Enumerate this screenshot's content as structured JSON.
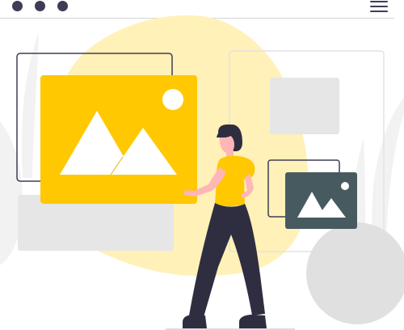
{
  "window": {
    "controls": [
      "window-dot",
      "window-dot",
      "window-dot"
    ],
    "menu_icon": "hamburger-menu-icon"
  },
  "illustration": {
    "colors": {
      "accent": "#ffc800",
      "blob": "#fff1b8",
      "dark": "#2f2e41",
      "frame_dark": "#3f3d56",
      "preview_tile": "#475a60",
      "placeholder_gray": "#e6e6e6",
      "outline_gray": "#d9d9d9",
      "plant_gray": "#f2f2f2",
      "circle_gray": "#e0e0e0",
      "skin": "#ffb6b6"
    },
    "icons": [
      "image-icon",
      "image-thumbnail-icon",
      "sun-icon",
      "mountain-icon"
    ]
  }
}
